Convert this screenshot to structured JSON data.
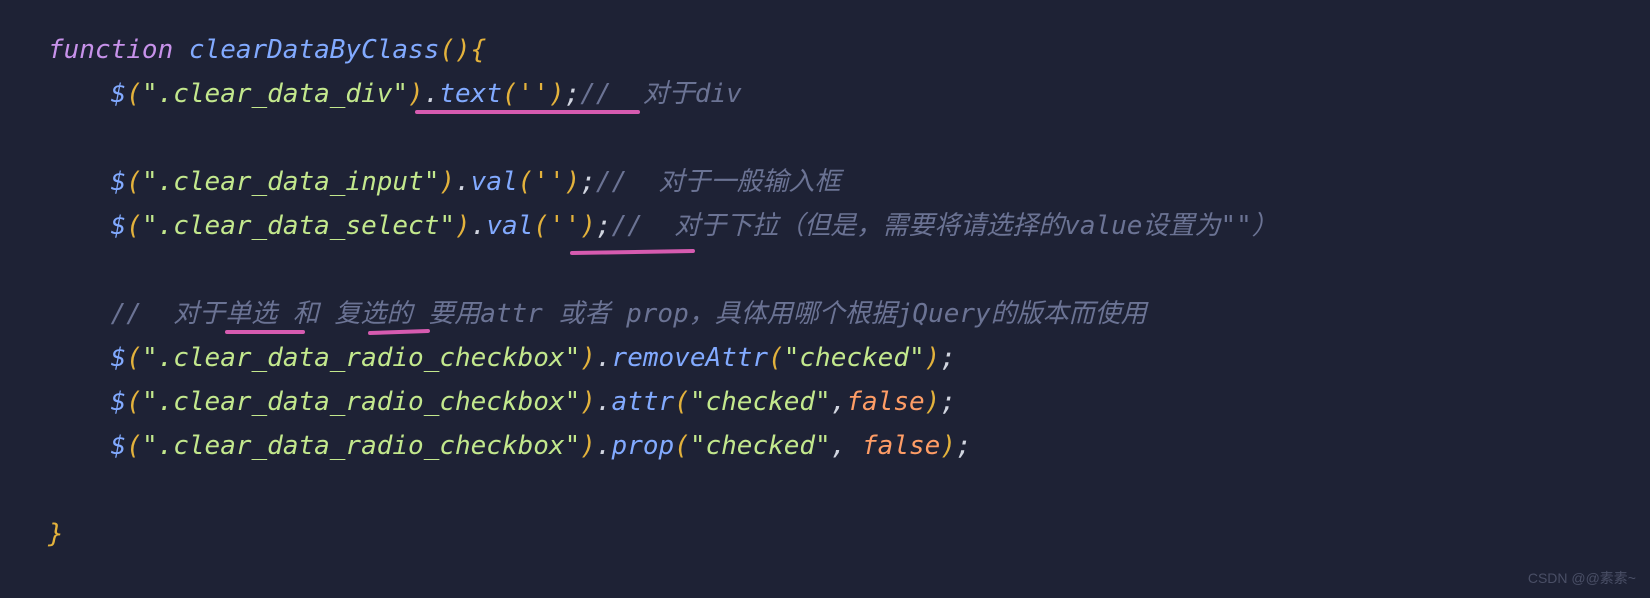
{
  "code": {
    "line1": {
      "kw": "function",
      "sp1": " ",
      "fn": "clearDataByClass",
      "open": "(){"
    },
    "line2": {
      "indent": "    ",
      "dollar": "$",
      "lp": "(",
      "str": "\".clear_data_div\"",
      "rp": ")",
      "dot1": ".",
      "m1": "text",
      "args": "('')",
      "semi": ";",
      "cmt": "//  对于div"
    },
    "blank1": " ",
    "line3": {
      "indent": "    ",
      "dollar": "$",
      "lp": "(",
      "str": "\".clear_data_input\"",
      "rp": ")",
      "dot1": ".",
      "m1": "val",
      "args": "('')",
      "semi": ";",
      "cmt": "//  对于一般输入框"
    },
    "line4": {
      "indent": "    ",
      "dollar": "$",
      "lp": "(",
      "str": "\".clear_data_select\"",
      "rp": ")",
      "dot1": ".",
      "m1": "val",
      "args": "('')",
      "semi": ";",
      "cmt": "//  对于下拉（但是，需要将请选择的value设置为\"\"）"
    },
    "blank2": " ",
    "line5": {
      "indent": "    ",
      "cmt": "//  对于单选 和 复选的 要用attr 或者 prop，具体用哪个根据jQuery的版本而使用"
    },
    "line6": {
      "indent": "    ",
      "dollar": "$",
      "lp": "(",
      "str": "\".clear_data_radio_checkbox\"",
      "rp": ")",
      "dot1": ".",
      "m1": "removeAttr",
      "lpa": "(",
      "arg1": "\"checked\"",
      "rpa": ")",
      "semi": ";"
    },
    "line7": {
      "indent": "    ",
      "dollar": "$",
      "lp": "(",
      "str": "\".clear_data_radio_checkbox\"",
      "rp": ")",
      "dot1": ".",
      "m1": "attr",
      "lpa": "(",
      "arg1": "\"checked\"",
      "comma": ",",
      "bool": "false",
      "rpa": ")",
      "semi": ";"
    },
    "line8": {
      "indent": "    ",
      "dollar": "$",
      "lp": "(",
      "str": "\".clear_data_radio_checkbox\"",
      "rp": ")",
      "dot1": ".",
      "m1": "prop",
      "lpa": "(",
      "arg1": "\"checked\"",
      "comma": ", ",
      "bool": "false",
      "rpa": ")",
      "semi": ";"
    },
    "blank3": " ",
    "close": "}"
  },
  "watermark": "CSDN @@素素~"
}
